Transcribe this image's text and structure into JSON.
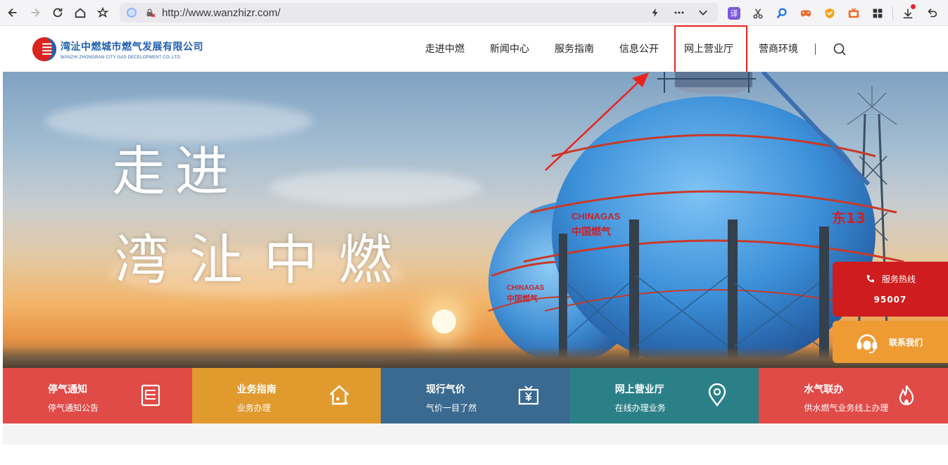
{
  "browser": {
    "url": "http://www.wanzhizr.com/",
    "icons": [
      "back-icon",
      "forward-icon",
      "reload-icon",
      "home-icon",
      "bookmark-star-icon",
      "lightning-icon",
      "more-icon",
      "chevron-down-icon",
      "translate-icon",
      "scissors-icon",
      "search-icon",
      "game-icon",
      "shield-icon",
      "tv-icon",
      "grid-icon",
      "download-icon",
      "undo-icon",
      "menu-icon"
    ],
    "translate_label": "译"
  },
  "site": {
    "logo_cn": "湾沚中燃城市燃气发展有限公司",
    "logo_en": "WANZHI ZHONGRAN CITY GAS DECELOPMENT CO.,LTD.",
    "nav": [
      {
        "label": "走进中燃"
      },
      {
        "label": "新闻中心"
      },
      {
        "label": "服务指南"
      },
      {
        "label": "信息公开"
      },
      {
        "label": "网上营业厅"
      },
      {
        "label": "营商环境"
      }
    ],
    "nav_divider": "|",
    "brand_color": "#1f5fae",
    "highlight_color": "#e8231f"
  },
  "hero": {
    "line1": "走进",
    "line2": "湾沚中燃",
    "tank_label_1": "CHINAGAS",
    "tank_label_2": "中国燃气",
    "tank_label_3": "东13"
  },
  "float_panel": {
    "hotline_label": "服务热线",
    "hotline_number": "95007",
    "contact_label": "联系我们"
  },
  "tiles": [
    {
      "title": "停气通知",
      "sub": "停气通知公告",
      "color": "#e04a47",
      "icon": "document-icon"
    },
    {
      "title": "业务指南",
      "sub": "业务办理",
      "color": "#e19a2e",
      "icon": "house-icon"
    },
    {
      "title": "现行气价",
      "sub": "气价一目了然",
      "color": "#3a6a90",
      "icon": "price-box-icon"
    },
    {
      "title": "网上营业厅",
      "sub": "在线办理业务",
      "color": "#2b8088",
      "icon": "location-pin-icon"
    },
    {
      "title": "水气联办",
      "sub": "供水燃气业务线上办理",
      "color": "#e04a47",
      "icon": "flame-icon"
    }
  ]
}
